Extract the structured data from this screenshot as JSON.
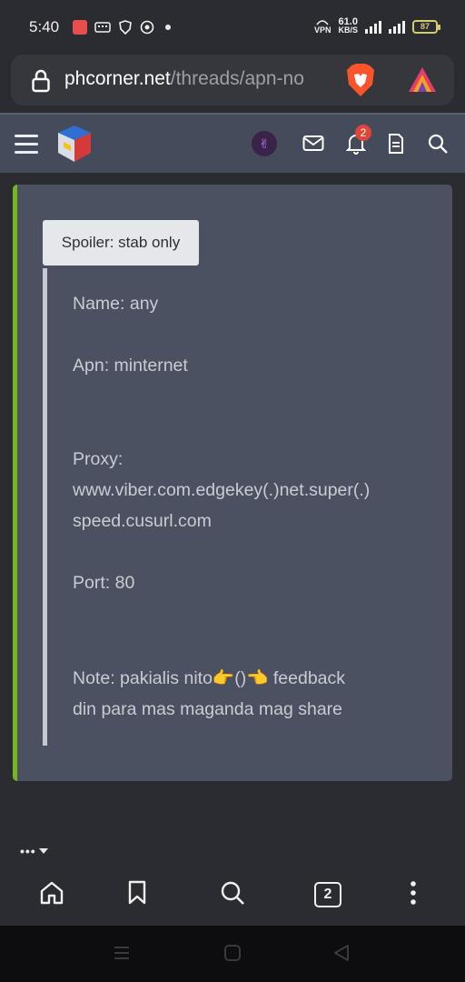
{
  "status_bar": {
    "time": "5:40",
    "speed_value": "61.0",
    "speed_unit": "KB/S",
    "vpn_label": "VPN",
    "battery": "87"
  },
  "url_bar": {
    "domain": "phcorner.net",
    "path": "/threads/apn-no"
  },
  "header": {
    "notification_count": "2"
  },
  "post": {
    "spoiler_label": "Spoiler: stab only",
    "lines": {
      "name": "Name: any",
      "apn": "Apn: minternet",
      "proxy_label": "Proxy:",
      "proxy_line1": "www.viber.com.edgekey(.)net.super(.)",
      "proxy_line2": "speed.cusurl.com",
      "port": "Port: 80",
      "note_line1": "Note: pakialis nito👉()👈 feedback",
      "note_line2": "din para mas maganda mag share"
    }
  },
  "toolbar": {
    "tabs_count": "2"
  },
  "colors": {
    "accent_green": "#79b51e",
    "header_bg": "#444b5a",
    "card_bg": "#4b5160",
    "badge_red": "#e0453a"
  }
}
